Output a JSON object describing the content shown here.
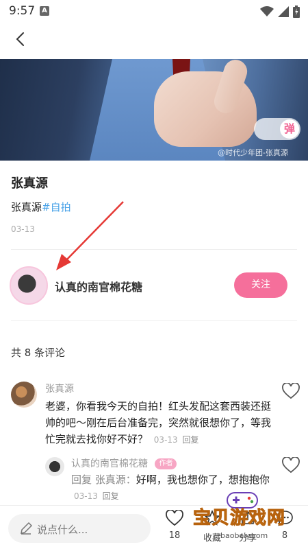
{
  "status_bar": {
    "time": "9:57",
    "notif_letter": "A"
  },
  "media": {
    "watermark": "@时代少年团-张真源",
    "danmu_label": "弹"
  },
  "post": {
    "title": "张真源",
    "body_text": "张真源",
    "hashtag": "#自拍",
    "date": "03-13"
  },
  "author": {
    "name": "认真的南官棉花糖",
    "follow_label": "关注"
  },
  "comments_header": "共 8 条评论",
  "comments": [
    {
      "name": "张真源",
      "text": "老婆，你看我今天的自拍！红头发配这套西装还挺帅的吧～刚在后台准备完，突然就很想你了，等我忙完就去找你好不好？",
      "date": "03-13",
      "reply_label": "回复",
      "replies": [
        {
          "name": "认真的南官棉花糖",
          "badge": "作者",
          "reply_prefix": "回复",
          "reply_to": "张真源：",
          "text": "好啊，我也想你了，想抱抱你",
          "date": "03-13",
          "reply_label": "回复"
        }
      ]
    }
  ],
  "bottom_bar": {
    "input_placeholder": "说点什么...",
    "like_count": "18",
    "collect_label": "收藏",
    "share_label": "分享",
    "comment_count": "8"
  },
  "site_watermark": {
    "title": "宝贝游戏网",
    "url": "baobeiy.com"
  },
  "colors": {
    "accent_pink": "#f56f9b",
    "hashtag_blue": "#4aa3e8",
    "badge_pink": "#f7a6c4"
  },
  "icons": [
    "back-icon",
    "heart-icon",
    "pen-icon",
    "comment-icon",
    "wifi-icon",
    "signal-icon",
    "battery-icon"
  ]
}
